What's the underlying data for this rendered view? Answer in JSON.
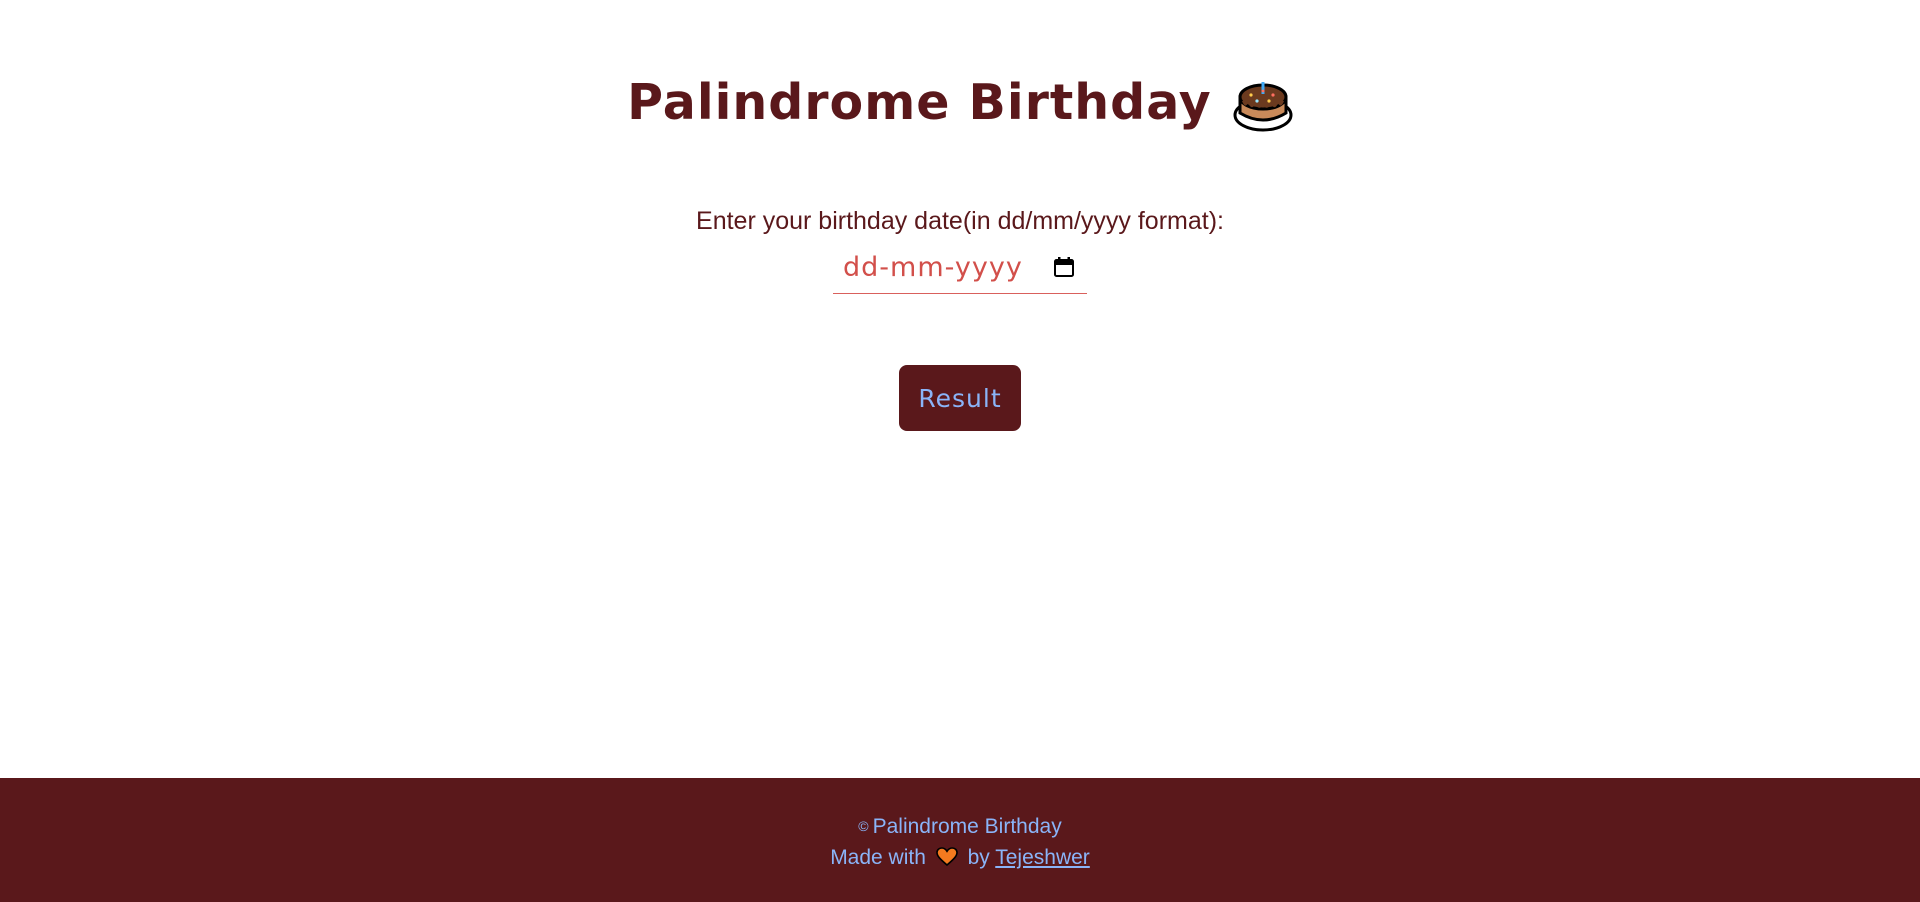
{
  "header": {
    "title": "Palindrome Birthday"
  },
  "form": {
    "label": "Enter your birthday date(in dd/mm/yyyy format):",
    "date_placeholder": "dd-mm-yyyy",
    "submit_label": "Result"
  },
  "footer": {
    "copyright_symbol": "©",
    "copyright_text": "Palindrome Birthday",
    "made_with": "Made with",
    "by": "by",
    "author": "Tejeshwer"
  },
  "icons": {
    "title_icon": "birthday-cake-icon",
    "date_picker_icon": "calendar-icon",
    "footer_icon": "orange-heart-icon"
  },
  "colors": {
    "primary": "#5a181b",
    "accent_text": "#8ab4f8",
    "input_text": "#d24f4a",
    "background": "#ffffff"
  }
}
